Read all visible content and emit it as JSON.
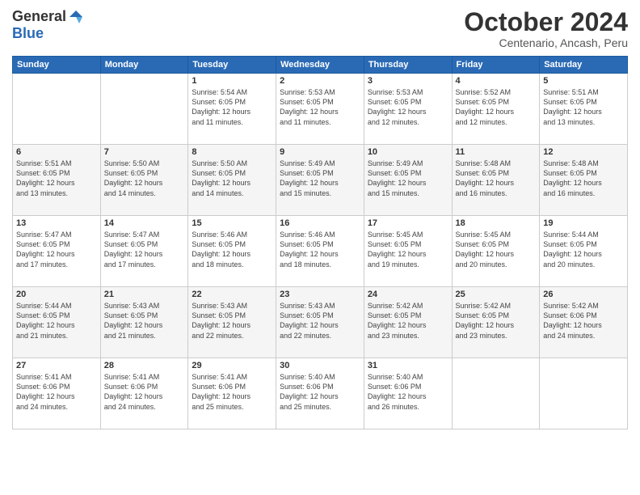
{
  "logo": {
    "general": "General",
    "blue": "Blue"
  },
  "title": "October 2024",
  "location": "Centenario, Ancash, Peru",
  "weekdays": [
    "Sunday",
    "Monday",
    "Tuesday",
    "Wednesday",
    "Thursday",
    "Friday",
    "Saturday"
  ],
  "weeks": [
    [
      {
        "day": "",
        "info": ""
      },
      {
        "day": "",
        "info": ""
      },
      {
        "day": "1",
        "info": "Sunrise: 5:54 AM\nSunset: 6:05 PM\nDaylight: 12 hours\nand 11 minutes."
      },
      {
        "day": "2",
        "info": "Sunrise: 5:53 AM\nSunset: 6:05 PM\nDaylight: 12 hours\nand 11 minutes."
      },
      {
        "day": "3",
        "info": "Sunrise: 5:53 AM\nSunset: 6:05 PM\nDaylight: 12 hours\nand 12 minutes."
      },
      {
        "day": "4",
        "info": "Sunrise: 5:52 AM\nSunset: 6:05 PM\nDaylight: 12 hours\nand 12 minutes."
      },
      {
        "day": "5",
        "info": "Sunrise: 5:51 AM\nSunset: 6:05 PM\nDaylight: 12 hours\nand 13 minutes."
      }
    ],
    [
      {
        "day": "6",
        "info": "Sunrise: 5:51 AM\nSunset: 6:05 PM\nDaylight: 12 hours\nand 13 minutes."
      },
      {
        "day": "7",
        "info": "Sunrise: 5:50 AM\nSunset: 6:05 PM\nDaylight: 12 hours\nand 14 minutes."
      },
      {
        "day": "8",
        "info": "Sunrise: 5:50 AM\nSunset: 6:05 PM\nDaylight: 12 hours\nand 14 minutes."
      },
      {
        "day": "9",
        "info": "Sunrise: 5:49 AM\nSunset: 6:05 PM\nDaylight: 12 hours\nand 15 minutes."
      },
      {
        "day": "10",
        "info": "Sunrise: 5:49 AM\nSunset: 6:05 PM\nDaylight: 12 hours\nand 15 minutes."
      },
      {
        "day": "11",
        "info": "Sunrise: 5:48 AM\nSunset: 6:05 PM\nDaylight: 12 hours\nand 16 minutes."
      },
      {
        "day": "12",
        "info": "Sunrise: 5:48 AM\nSunset: 6:05 PM\nDaylight: 12 hours\nand 16 minutes."
      }
    ],
    [
      {
        "day": "13",
        "info": "Sunrise: 5:47 AM\nSunset: 6:05 PM\nDaylight: 12 hours\nand 17 minutes."
      },
      {
        "day": "14",
        "info": "Sunrise: 5:47 AM\nSunset: 6:05 PM\nDaylight: 12 hours\nand 17 minutes."
      },
      {
        "day": "15",
        "info": "Sunrise: 5:46 AM\nSunset: 6:05 PM\nDaylight: 12 hours\nand 18 minutes."
      },
      {
        "day": "16",
        "info": "Sunrise: 5:46 AM\nSunset: 6:05 PM\nDaylight: 12 hours\nand 18 minutes."
      },
      {
        "day": "17",
        "info": "Sunrise: 5:45 AM\nSunset: 6:05 PM\nDaylight: 12 hours\nand 19 minutes."
      },
      {
        "day": "18",
        "info": "Sunrise: 5:45 AM\nSunset: 6:05 PM\nDaylight: 12 hours\nand 20 minutes."
      },
      {
        "day": "19",
        "info": "Sunrise: 5:44 AM\nSunset: 6:05 PM\nDaylight: 12 hours\nand 20 minutes."
      }
    ],
    [
      {
        "day": "20",
        "info": "Sunrise: 5:44 AM\nSunset: 6:05 PM\nDaylight: 12 hours\nand 21 minutes."
      },
      {
        "day": "21",
        "info": "Sunrise: 5:43 AM\nSunset: 6:05 PM\nDaylight: 12 hours\nand 21 minutes."
      },
      {
        "day": "22",
        "info": "Sunrise: 5:43 AM\nSunset: 6:05 PM\nDaylight: 12 hours\nand 22 minutes."
      },
      {
        "day": "23",
        "info": "Sunrise: 5:43 AM\nSunset: 6:05 PM\nDaylight: 12 hours\nand 22 minutes."
      },
      {
        "day": "24",
        "info": "Sunrise: 5:42 AM\nSunset: 6:05 PM\nDaylight: 12 hours\nand 23 minutes."
      },
      {
        "day": "25",
        "info": "Sunrise: 5:42 AM\nSunset: 6:05 PM\nDaylight: 12 hours\nand 23 minutes."
      },
      {
        "day": "26",
        "info": "Sunrise: 5:42 AM\nSunset: 6:06 PM\nDaylight: 12 hours\nand 24 minutes."
      }
    ],
    [
      {
        "day": "27",
        "info": "Sunrise: 5:41 AM\nSunset: 6:06 PM\nDaylight: 12 hours\nand 24 minutes."
      },
      {
        "day": "28",
        "info": "Sunrise: 5:41 AM\nSunset: 6:06 PM\nDaylight: 12 hours\nand 24 minutes."
      },
      {
        "day": "29",
        "info": "Sunrise: 5:41 AM\nSunset: 6:06 PM\nDaylight: 12 hours\nand 25 minutes."
      },
      {
        "day": "30",
        "info": "Sunrise: 5:40 AM\nSunset: 6:06 PM\nDaylight: 12 hours\nand 25 minutes."
      },
      {
        "day": "31",
        "info": "Sunrise: 5:40 AM\nSunset: 6:06 PM\nDaylight: 12 hours\nand 26 minutes."
      },
      {
        "day": "",
        "info": ""
      },
      {
        "day": "",
        "info": ""
      }
    ]
  ]
}
